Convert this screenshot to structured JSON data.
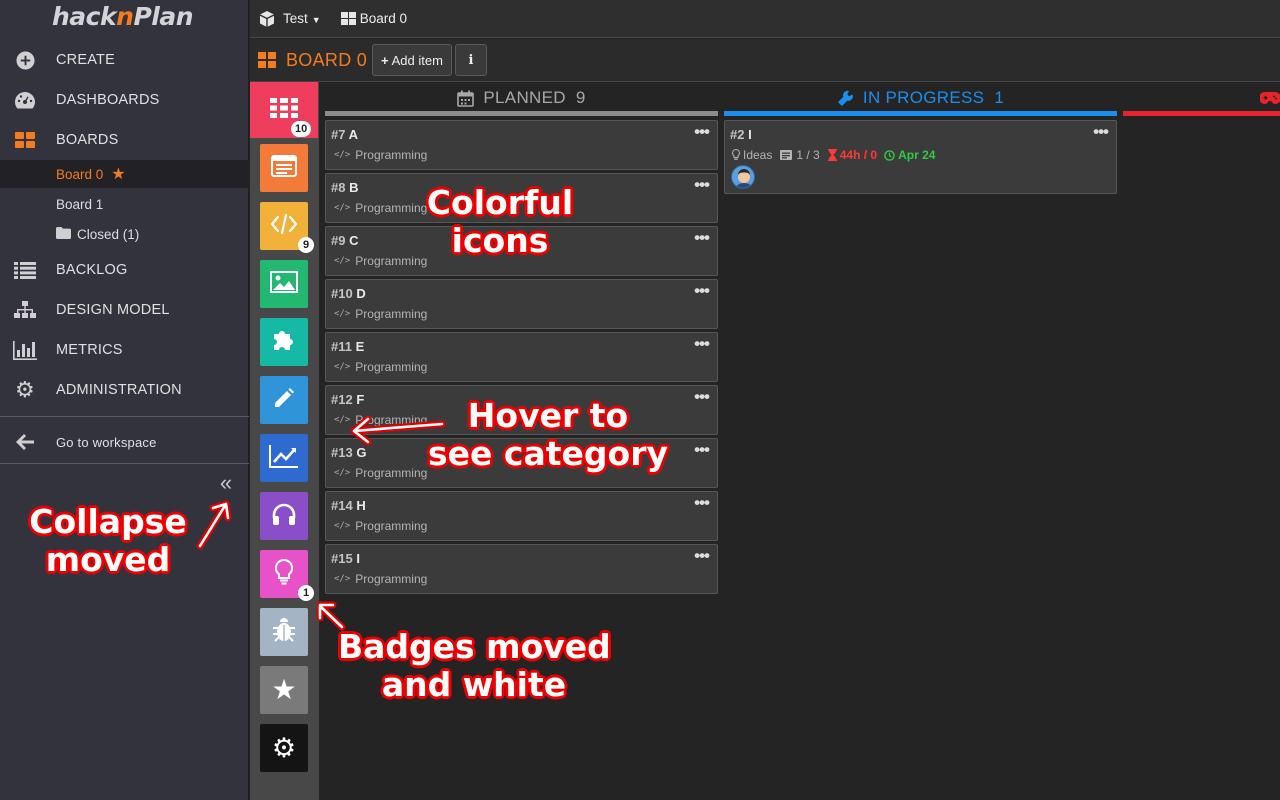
{
  "app": {
    "logo_left": "hack",
    "logo_n": "n",
    "logo_right": "Plan",
    "brand_color": "#f47b20"
  },
  "sidebar": {
    "nav": [
      {
        "label": "CREATE",
        "icon": "plus-circle-icon"
      },
      {
        "label": "DASHBOARDS",
        "icon": "dashboard-icon"
      },
      {
        "label": "BOARDS",
        "icon": "boards-icon"
      },
      {
        "label": "BACKLOG",
        "icon": "list-icon"
      },
      {
        "label": "DESIGN MODEL",
        "icon": "sitemap-icon"
      },
      {
        "label": "METRICS",
        "icon": "bar-chart-icon"
      },
      {
        "label": "ADMINISTRATION",
        "icon": "gear-icon"
      }
    ],
    "boards": [
      {
        "label": "Board 0"
      },
      {
        "label": "Board 1"
      },
      {
        "label": "Closed (1)"
      }
    ],
    "workspace_link": "Go to workspace",
    "collapse_glyph": "«"
  },
  "topbar": {
    "project": "Test",
    "board": "Board 0"
  },
  "boardbar": {
    "title": "BOARD 0",
    "add_item": "Add item",
    "info": "i"
  },
  "categories": [
    {
      "name": "all",
      "color": "#ef3e5d",
      "badge": "10"
    },
    {
      "name": "board",
      "color": "#f47a3a"
    },
    {
      "name": "programming",
      "color": "#f2b23a",
      "badge": "9"
    },
    {
      "name": "art",
      "color": "#22b872"
    },
    {
      "name": "design",
      "color": "#16b8a6"
    },
    {
      "name": "writing",
      "color": "#2f95d8"
    },
    {
      "name": "marketing",
      "color": "#2f6ad0"
    },
    {
      "name": "sound",
      "color": "#8a4fc8"
    },
    {
      "name": "ideas",
      "color": "#e852c8",
      "badge": "1"
    },
    {
      "name": "bugs",
      "color": "#a5b4c4"
    },
    {
      "name": "favorites",
      "color": "#7a7a7a"
    },
    {
      "name": "settings",
      "color": "#141414"
    }
  ],
  "columns": [
    {
      "name": "PLANNED",
      "count": "9",
      "color": "#8c8c8c"
    },
    {
      "name": "IN PROGRESS",
      "count": "1",
      "color": "#1a8fef"
    },
    {
      "name": "",
      "count": "",
      "color": "#e8232c"
    }
  ],
  "planned_cards": [
    {
      "num": "#7",
      "title": "A",
      "category": "Programming"
    },
    {
      "num": "#8",
      "title": "B",
      "category": "Programming"
    },
    {
      "num": "#9",
      "title": "C",
      "category": "Programming"
    },
    {
      "num": "#10",
      "title": "D",
      "category": "Programming"
    },
    {
      "num": "#11",
      "title": "E",
      "category": "Programming"
    },
    {
      "num": "#12",
      "title": "F",
      "category": "Programming"
    },
    {
      "num": "#13",
      "title": "G",
      "category": "Programming"
    },
    {
      "num": "#14",
      "title": "H",
      "category": "Programming"
    },
    {
      "num": "#15",
      "title": "I",
      "category": "Programming"
    }
  ],
  "inprogress_cards": [
    {
      "num": "#2",
      "title": "I",
      "category": "Ideas",
      "subtasks": "1 / 3",
      "hours": "44h / 0",
      "due": "Apr 24"
    }
  ],
  "annotations": {
    "colorful_line1": "Colorful",
    "colorful_line2": "icons",
    "hover_line1": "Hover to",
    "hover_line2": "see category",
    "collapse_line1": "Collapse",
    "collapse_line2": "moved",
    "badges_line1": "Badges moved",
    "badges_line2": "and white",
    "annotation_color": "#e00000"
  },
  "card_dots": "•••"
}
